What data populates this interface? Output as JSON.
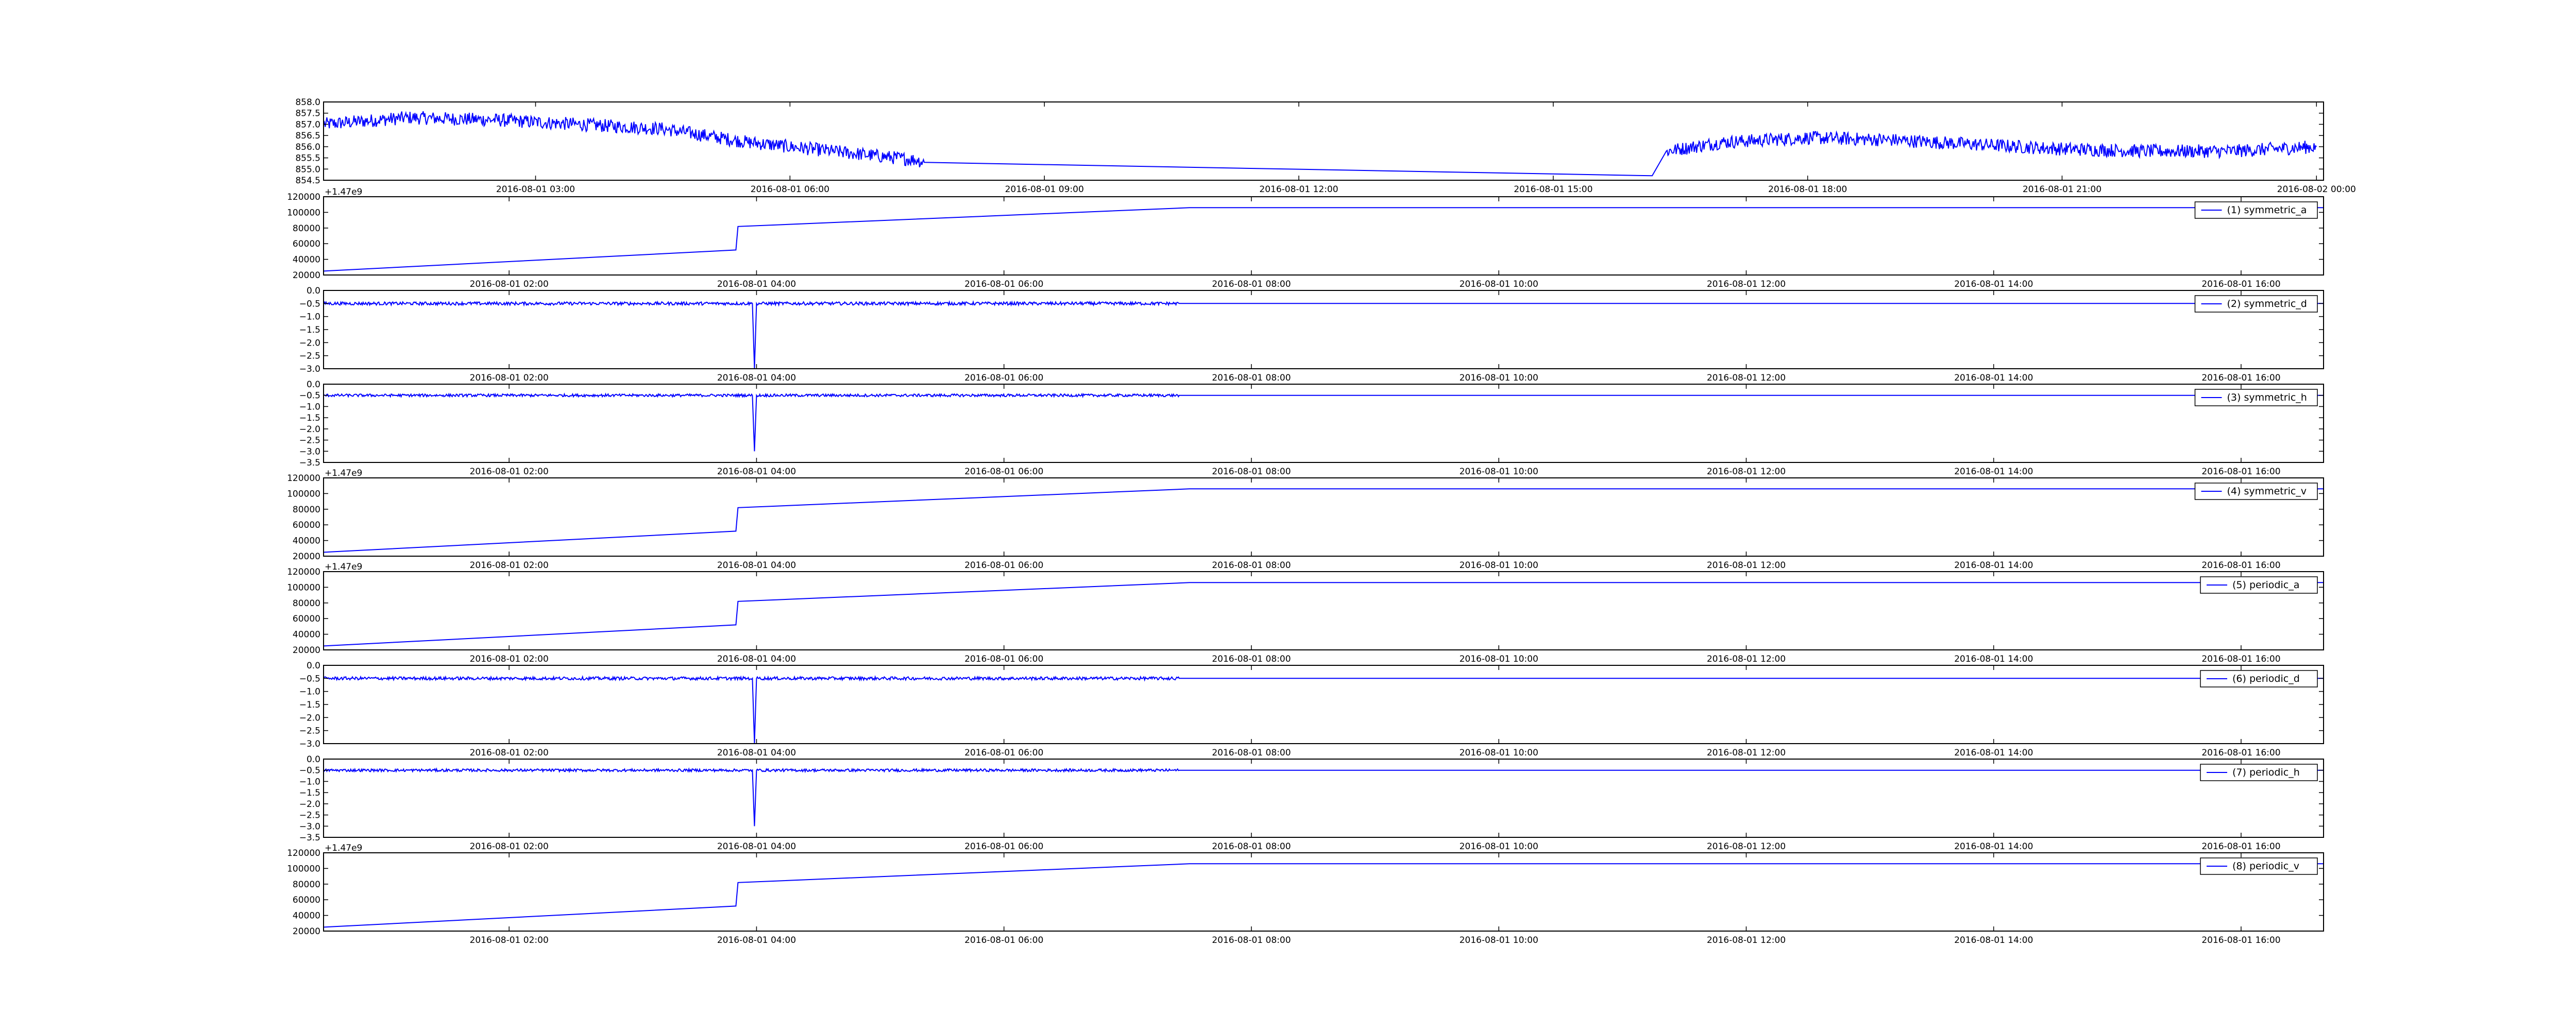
{
  "colors": {
    "line": "#0000ff",
    "axes": "#000000",
    "background": "#ffffff"
  },
  "chart_data": [
    {
      "type": "line",
      "name": "top",
      "x_type": "datetime",
      "xlim": [
        "2016-08-01 00:30",
        "2016-08-02 00:05"
      ],
      "xticks": [
        "2016-08-01 03:00",
        "2016-08-01 06:00",
        "2016-08-01 09:00",
        "2016-08-01 12:00",
        "2016-08-01 15:00",
        "2016-08-01 18:00",
        "2016-08-01 21:00",
        "2016-08-02 00:00"
      ],
      "ylim": [
        854.5,
        858.0
      ],
      "yticks": [
        "858.0",
        "857.5",
        "857.0",
        "856.5",
        "856.0",
        "855.5",
        "855.0",
        "854.5"
      ],
      "offset_text": "",
      "legend": "",
      "x": [
        "2016-08-01 00:30",
        "2016-08-01 01:30",
        "2016-08-01 02:30",
        "2016-08-01 03:30",
        "2016-08-01 04:30",
        "2016-08-01 05:30",
        "2016-08-01 06:30",
        "2016-08-01 07:30",
        "2016-08-01 07:35",
        "2016-08-01 16:10",
        "2016-08-01 16:20",
        "2016-08-01 17:00",
        "2016-08-01 18:00",
        "2016-08-01 19:00",
        "2016-08-01 20:00",
        "2016-08-01 21:00",
        "2016-08-01 22:00",
        "2016-08-01 23:00",
        "2016-08-02 00:00"
      ],
      "values": [
        857.0,
        857.3,
        857.2,
        857.0,
        856.8,
        856.2,
        855.8,
        855.4,
        855.3,
        854.7,
        855.8,
        856.2,
        856.4,
        856.3,
        856.1,
        855.9,
        855.8,
        855.8,
        856.0
      ],
      "noise": 0.3,
      "noisy_ranges": [
        [
          0,
          8
        ],
        [
          10,
          18
        ]
      ]
    },
    {
      "type": "line",
      "name": "symmetric_a",
      "x_type": "datetime",
      "xlim": [
        "2016-08-01 00:30",
        "2016-08-01 16:40"
      ],
      "xticks": [
        "2016-08-01 02:00",
        "2016-08-01 04:00",
        "2016-08-01 06:00",
        "2016-08-01 08:00",
        "2016-08-01 10:00",
        "2016-08-01 12:00",
        "2016-08-01 14:00",
        "2016-08-01 16:00"
      ],
      "ylim": [
        20000,
        120000
      ],
      "yticks": [
        "120000",
        "100000",
        "80000",
        "60000",
        "40000",
        "20000"
      ],
      "offset_text": "+1.47e9",
      "legend": "(1) symmetric_a",
      "x": [
        "2016-08-01 00:30",
        "2016-08-01 03:50",
        "2016-08-01 03:51",
        "2016-08-01 07:30",
        "2016-08-01 16:40"
      ],
      "values": [
        25000,
        52000,
        82000,
        106000,
        106000
      ],
      "noise": 0,
      "noisy_ranges": []
    },
    {
      "type": "line",
      "name": "symmetric_d",
      "x_type": "datetime",
      "xlim": [
        "2016-08-01 00:30",
        "2016-08-01 16:40"
      ],
      "xticks": [
        "2016-08-01 02:00",
        "2016-08-01 04:00",
        "2016-08-01 06:00",
        "2016-08-01 08:00",
        "2016-08-01 10:00",
        "2016-08-01 12:00",
        "2016-08-01 14:00",
        "2016-08-01 16:00"
      ],
      "ylim": [
        -3.0,
        0.0
      ],
      "yticks": [
        "0.0",
        "−0.5",
        "−1.0",
        "−1.5",
        "−2.0",
        "−2.5",
        "−3.0"
      ],
      "offset_text": "",
      "legend": "(2) symmetric_d",
      "x": [
        "2016-08-01 00:30",
        "2016-08-01 03:58",
        "2016-08-01 03:59",
        "2016-08-01 04:00",
        "2016-08-01 07:25",
        "2016-08-01 16:40"
      ],
      "values": [
        -0.5,
        -0.5,
        -3.0,
        -0.5,
        -0.5,
        -0.5
      ],
      "noise": 0.06,
      "noisy_ranges": [
        [
          0,
          1
        ],
        [
          3,
          4
        ]
      ]
    },
    {
      "type": "line",
      "name": "symmetric_h",
      "x_type": "datetime",
      "xlim": [
        "2016-08-01 00:30",
        "2016-08-01 16:40"
      ],
      "xticks": [
        "2016-08-01 02:00",
        "2016-08-01 04:00",
        "2016-08-01 06:00",
        "2016-08-01 08:00",
        "2016-08-01 10:00",
        "2016-08-01 12:00",
        "2016-08-01 14:00",
        "2016-08-01 16:00"
      ],
      "ylim": [
        -3.5,
        0.0
      ],
      "yticks": [
        "0.0",
        "−0.5",
        "−1.0",
        "−1.5",
        "−2.0",
        "−2.5",
        "−3.0",
        "−3.5"
      ],
      "offset_text": "",
      "legend": "(3) symmetric_h",
      "x": [
        "2016-08-01 00:30",
        "2016-08-01 03:58",
        "2016-08-01 03:59",
        "2016-08-01 04:00",
        "2016-08-01 07:25",
        "2016-08-01 16:40"
      ],
      "values": [
        -0.5,
        -0.5,
        -3.0,
        -0.5,
        -0.5,
        -0.5
      ],
      "noise": 0.06,
      "noisy_ranges": [
        [
          0,
          1
        ],
        [
          3,
          4
        ]
      ]
    },
    {
      "type": "line",
      "name": "symmetric_v",
      "x_type": "datetime",
      "xlim": [
        "2016-08-01 00:30",
        "2016-08-01 16:40"
      ],
      "xticks": [
        "2016-08-01 02:00",
        "2016-08-01 04:00",
        "2016-08-01 06:00",
        "2016-08-01 08:00",
        "2016-08-01 10:00",
        "2016-08-01 12:00",
        "2016-08-01 14:00",
        "2016-08-01 16:00"
      ],
      "ylim": [
        20000,
        120000
      ],
      "yticks": [
        "120000",
        "100000",
        "80000",
        "60000",
        "40000",
        "20000"
      ],
      "offset_text": "+1.47e9",
      "legend": "(4) symmetric_v",
      "x": [
        "2016-08-01 00:30",
        "2016-08-01 03:50",
        "2016-08-01 03:51",
        "2016-08-01 07:30",
        "2016-08-01 16:40"
      ],
      "values": [
        25000,
        52000,
        82000,
        106000,
        106000
      ],
      "noise": 0,
      "noisy_ranges": []
    },
    {
      "type": "line",
      "name": "periodic_a",
      "x_type": "datetime",
      "xlim": [
        "2016-08-01 00:30",
        "2016-08-01 16:40"
      ],
      "xticks": [
        "2016-08-01 02:00",
        "2016-08-01 04:00",
        "2016-08-01 06:00",
        "2016-08-01 08:00",
        "2016-08-01 10:00",
        "2016-08-01 12:00",
        "2016-08-01 14:00",
        "2016-08-01 16:00"
      ],
      "ylim": [
        20000,
        120000
      ],
      "yticks": [
        "120000",
        "100000",
        "80000",
        "60000",
        "40000",
        "20000"
      ],
      "offset_text": "+1.47e9",
      "legend": "(5) periodic_a",
      "x": [
        "2016-08-01 00:30",
        "2016-08-01 03:50",
        "2016-08-01 03:51",
        "2016-08-01 07:30",
        "2016-08-01 16:40"
      ],
      "values": [
        25000,
        52000,
        82000,
        106000,
        106000
      ],
      "noise": 0,
      "noisy_ranges": []
    },
    {
      "type": "line",
      "name": "periodic_d",
      "x_type": "datetime",
      "xlim": [
        "2016-08-01 00:30",
        "2016-08-01 16:40"
      ],
      "xticks": [
        "2016-08-01 02:00",
        "2016-08-01 04:00",
        "2016-08-01 06:00",
        "2016-08-01 08:00",
        "2016-08-01 10:00",
        "2016-08-01 12:00",
        "2016-08-01 14:00",
        "2016-08-01 16:00"
      ],
      "ylim": [
        -3.0,
        0.0
      ],
      "yticks": [
        "0.0",
        "−0.5",
        "−1.0",
        "−1.5",
        "−2.0",
        "−2.5",
        "−3.0"
      ],
      "offset_text": "",
      "legend": "(6) periodic_d",
      "x": [
        "2016-08-01 00:30",
        "2016-08-01 03:58",
        "2016-08-01 03:59",
        "2016-08-01 04:00",
        "2016-08-01 07:25",
        "2016-08-01 16:40"
      ],
      "values": [
        -0.5,
        -0.5,
        -3.0,
        -0.5,
        -0.5,
        -0.5
      ],
      "noise": 0.06,
      "noisy_ranges": [
        [
          0,
          1
        ],
        [
          3,
          4
        ]
      ]
    },
    {
      "type": "line",
      "name": "periodic_h",
      "x_type": "datetime",
      "xlim": [
        "2016-08-01 00:30",
        "2016-08-01 16:40"
      ],
      "xticks": [
        "2016-08-01 02:00",
        "2016-08-01 04:00",
        "2016-08-01 06:00",
        "2016-08-01 08:00",
        "2016-08-01 10:00",
        "2016-08-01 12:00",
        "2016-08-01 14:00",
        "2016-08-01 16:00"
      ],
      "ylim": [
        -3.5,
        0.0
      ],
      "yticks": [
        "0.0",
        "−0.5",
        "−1.0",
        "−1.5",
        "−2.0",
        "−2.5",
        "−3.0",
        "−3.5"
      ],
      "offset_text": "",
      "legend": "(7) periodic_h",
      "x": [
        "2016-08-01 00:30",
        "2016-08-01 03:58",
        "2016-08-01 03:59",
        "2016-08-01 04:00",
        "2016-08-01 07:25",
        "2016-08-01 16:40"
      ],
      "values": [
        -0.5,
        -0.5,
        -3.0,
        -0.5,
        -0.5,
        -0.5
      ],
      "noise": 0.06,
      "noisy_ranges": [
        [
          0,
          1
        ],
        [
          3,
          4
        ]
      ]
    },
    {
      "type": "line",
      "name": "periodic_v",
      "x_type": "datetime",
      "xlim": [
        "2016-08-01 00:30",
        "2016-08-01 16:40"
      ],
      "xticks": [
        "2016-08-01 02:00",
        "2016-08-01 04:00",
        "2016-08-01 06:00",
        "2016-08-01 08:00",
        "2016-08-01 10:00",
        "2016-08-01 12:00",
        "2016-08-01 14:00",
        "2016-08-01 16:00"
      ],
      "ylim": [
        20000,
        120000
      ],
      "yticks": [
        "120000",
        "100000",
        "80000",
        "60000",
        "40000",
        "20000"
      ],
      "offset_text": "+1.47e9",
      "legend": "(8) periodic_v",
      "x": [
        "2016-08-01 00:30",
        "2016-08-01 03:50",
        "2016-08-01 03:51",
        "2016-08-01 07:30",
        "2016-08-01 16:40"
      ],
      "values": [
        25000,
        52000,
        82000,
        106000,
        106000
      ],
      "noise": 0,
      "noisy_ranges": []
    }
  ]
}
